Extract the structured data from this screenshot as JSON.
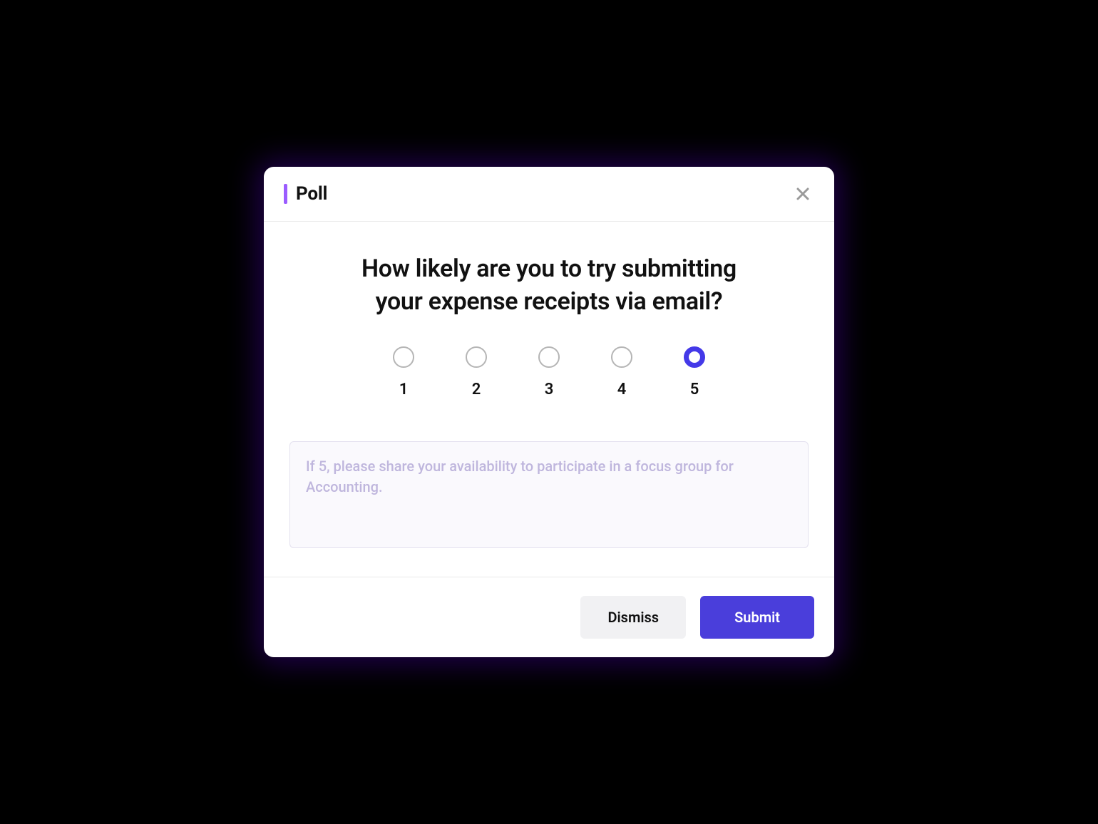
{
  "header": {
    "title": "Poll"
  },
  "question": "How likely are you to try submitting your expense receipts via email?",
  "rating": {
    "options": [
      "1",
      "2",
      "3",
      "4",
      "5"
    ],
    "selected_index": 4
  },
  "comment": {
    "placeholder": "If 5, please share your availability to participate in a focus group for Accounting.",
    "value": ""
  },
  "actions": {
    "dismiss_label": "Dismiss",
    "submit_label": "Submit"
  },
  "colors": {
    "accent": "#9b5cff",
    "primary": "#4a3edb",
    "radio_selected": "#4439e8"
  }
}
